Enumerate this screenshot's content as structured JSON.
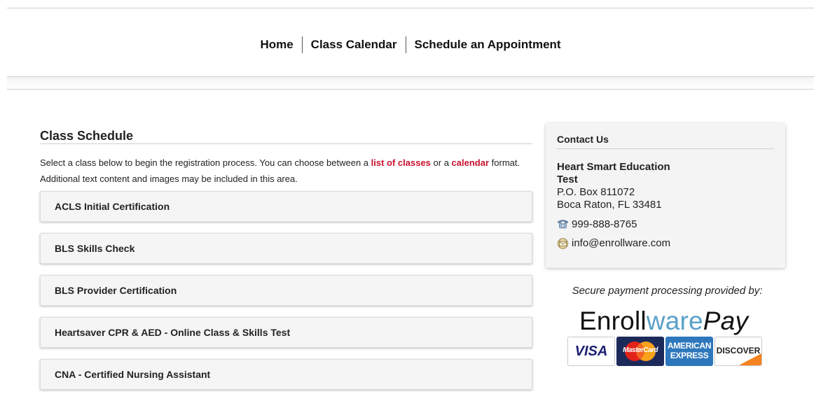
{
  "nav": {
    "items": [
      {
        "label": "Home"
      },
      {
        "label": "Class Calendar"
      },
      {
        "label": "Schedule an Appointment"
      }
    ]
  },
  "main": {
    "title": "Class Schedule",
    "intro": {
      "part1": "Select a class below to begin the registration process.  You can choose between a ",
      "link1": "list of classes",
      "part2": " or a ",
      "link2": "calendar",
      "part3": " format.",
      "line2": "Additional text content and images may be included in this area."
    },
    "classes": [
      "ACLS Initial Certification",
      "BLS Skills Check",
      "BLS Provider Certification",
      "Heartsaver CPR & AED - Online Class & Skills Test",
      "CNA - Certified Nursing Assistant"
    ]
  },
  "contact": {
    "title": "Contact Us",
    "org_name": "Heart Smart Education Test",
    "address_line1": "P.O. Box 811072",
    "address_line2": "Boca Raton, FL 33481",
    "phone": "999-888-8765",
    "email": "info@enrollware.com",
    "icons": {
      "phone": "phone-icon",
      "email": "email-icon"
    }
  },
  "payment": {
    "caption": "Secure payment processing provided by:",
    "logo": {
      "part1": "Enroll",
      "part2": "ware",
      "part3": "Pay"
    },
    "cards": [
      {
        "name": "visa",
        "text": "VISA"
      },
      {
        "name": "mastercard",
        "text": "MasterCard"
      },
      {
        "name": "amex",
        "text_line1": "AMERICAN",
        "text_line2": "EXPRESS"
      },
      {
        "name": "discover",
        "text": "DISCOVER"
      }
    ]
  },
  "colors": {
    "link": "#c8102e",
    "accent_blue": "#5aa0c8",
    "panel_bg": "#f4f4f4"
  }
}
